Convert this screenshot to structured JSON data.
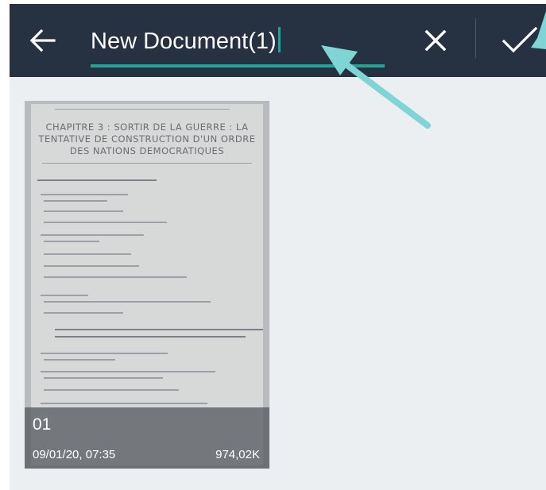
{
  "toolbar": {
    "document_name": "New Document(1)",
    "background_color": "#263141",
    "accent_color": "#1fa697",
    "back_icon": "arrow-left-icon",
    "clear_icon": "close-icon",
    "confirm_icon": "checkmark-icon"
  },
  "document": {
    "page_number": "01",
    "date": "09/01/20, 07:35",
    "size": "974,02K",
    "heading_lines": [
      "CHAPITRE 3 : SORTIR DE LA GUERRE : LA",
      "TENTATIVE DE CONSTRUCTION D'UN ORDRE",
      "DES NATIONS DEMOCRATIQUES"
    ]
  },
  "annotation": {
    "arrow_color": "#7fd4d6"
  }
}
